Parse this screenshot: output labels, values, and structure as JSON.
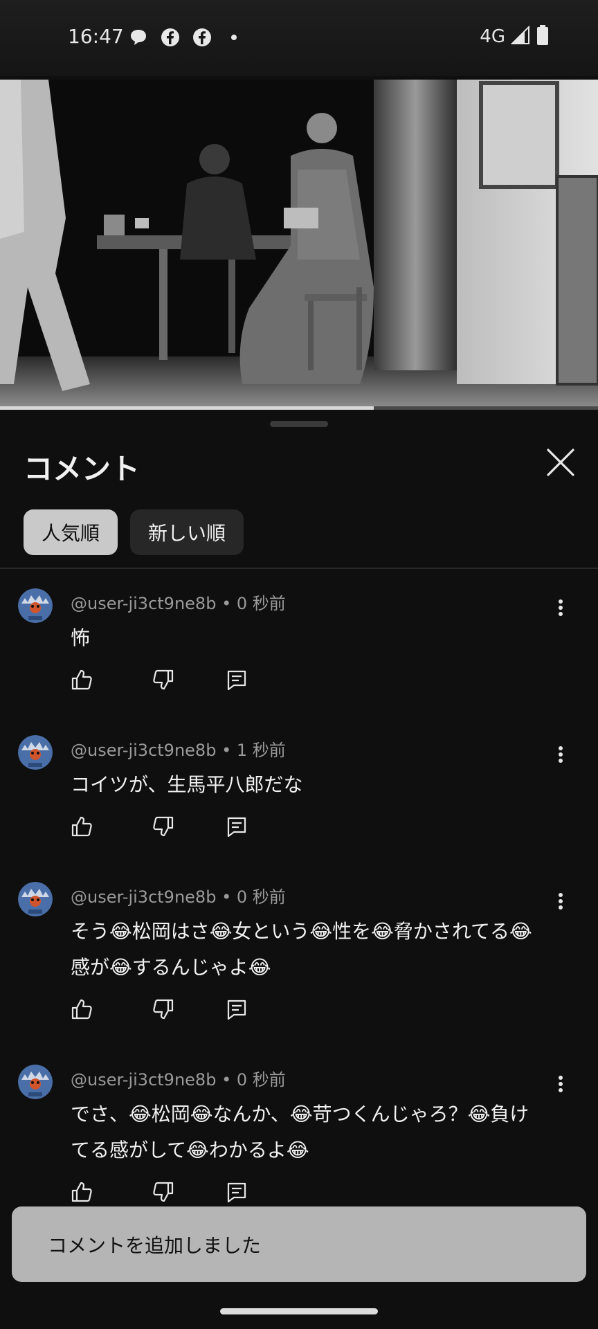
{
  "status_bar": {
    "time": "16:47",
    "notification_icons": [
      "chat-bubble-icon",
      "facebook-icon",
      "facebook-icon",
      "dot-icon"
    ],
    "network": "4G",
    "signal_icon": "signal-icon",
    "battery_icon": "battery-icon"
  },
  "video": {
    "progress": 0.625
  },
  "sheet": {
    "title": "コメント",
    "close_icon": "close-icon",
    "chips": [
      {
        "label": "人気順",
        "selected": true
      },
      {
        "label": "新しい順",
        "selected": false
      }
    ]
  },
  "comments": [
    {
      "username": "@user-ji3ct9ne8b",
      "time": "0 秒前",
      "text": "怖"
    },
    {
      "username": "@user-ji3ct9ne8b",
      "time": "1 秒前",
      "text": "コイツが、生馬平八郎だな"
    },
    {
      "username": "@user-ji3ct9ne8b",
      "time": "0 秒前",
      "text": "そう😂松岡はさ😂女という😂性を😂脅かされてる😂感が😂するんじゃよ😂"
    },
    {
      "username": "@user-ji3ct9ne8b",
      "time": "0 秒前",
      "text": "でさ、😂松岡😂なんか、😂苛つくんじゃろ？😂負けてる感がして😂わかるよ😂"
    }
  ],
  "snackbar": {
    "text": "コメントを追加しました"
  },
  "colors": {
    "background": "#0f0f0f",
    "chip_active": "#c9c9c9",
    "chip_inactive": "#272727",
    "snackbar": "#b5b5b5",
    "avatar": "#4a6fa8"
  }
}
